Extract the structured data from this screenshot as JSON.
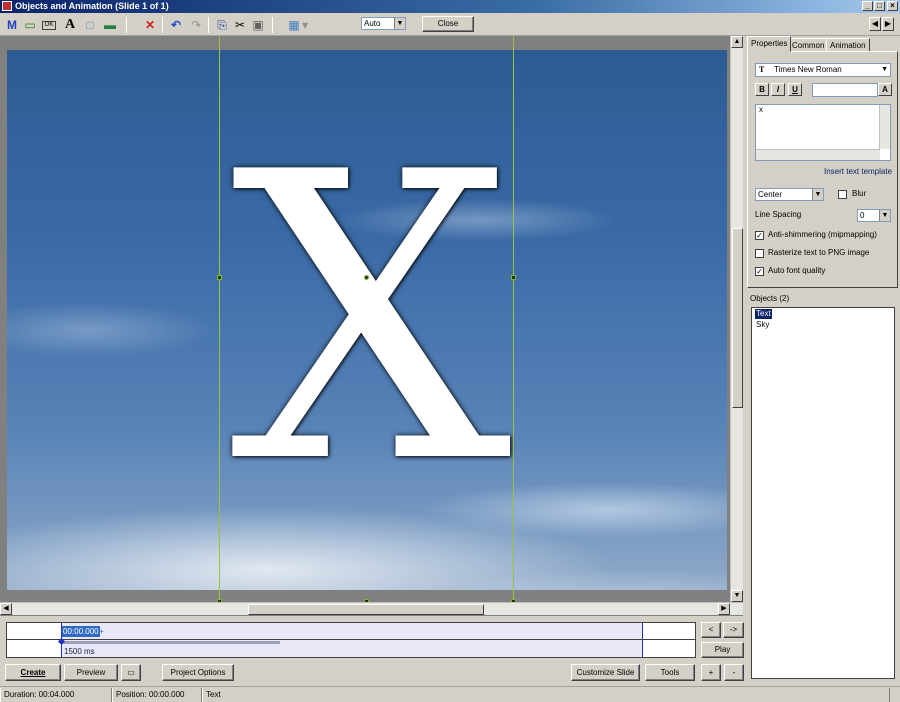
{
  "window": {
    "title": "Objects and Animation  (Slide 1 of 1)",
    "minimize_glyph": "_",
    "maximize_glyph": "□",
    "close_glyph": "×"
  },
  "toolbar": {
    "icons": {
      "add_text_m": "M",
      "add_rectangle": "▭",
      "add_button": "OK",
      "add_text_a": "A",
      "add_frame": "□",
      "add_image": "▬",
      "delete": "✕",
      "undo": "↶",
      "redo": "↷",
      "copy": "⎘",
      "cut": "✂",
      "paste": "▣",
      "grid": "▦",
      "grid_dropdown": "▾"
    },
    "zoom_value": "Auto",
    "close_label": "Close",
    "nav_prev": "◀",
    "nav_next": "▶"
  },
  "canvas": {
    "letter": "X",
    "scroll_up": "▲",
    "scroll_down": "▼",
    "scroll_left": "◀",
    "scroll_right": "▶"
  },
  "timeline": {
    "time": "00:00.000",
    "plus": "+",
    "duration_label": "1500 ms",
    "btn_prev": "<",
    "btn_next": "->",
    "play_label": "Play",
    "zoom_in": "+",
    "zoom_out": "-"
  },
  "bottom": {
    "create_label": "Create",
    "preview_label": "Preview",
    "project_options_label": "Project Options",
    "customize_slide_label": "Customize Slide",
    "tools_label": "Tools"
  },
  "status": {
    "duration": "Duration:  00:04.000",
    "position": "Position:  00:00.000",
    "selected": "Text"
  },
  "side": {
    "tabs": [
      "Properties",
      "Common",
      "Animation"
    ],
    "font_name": "Times New Roman",
    "bold": "B",
    "italic": "I",
    "underline": "U",
    "color_a": "A",
    "text_content": "x",
    "insert_template": "Insert text template",
    "align_value": "Center",
    "blur_label": "Blur",
    "line_spacing_label": "Line Spacing",
    "line_spacing_value": "0",
    "anti_shimmer_label": "Anti-shimmering (mipmapping)",
    "anti_shimmer_checked": true,
    "rasterize_label": "Rasterize text to PNG image",
    "rasterize_checked": false,
    "auto_font_label": "Auto font quality",
    "auto_font_checked": true,
    "objects_label": "Objects (2)",
    "objects": [
      "Text",
      "Sky"
    ]
  }
}
